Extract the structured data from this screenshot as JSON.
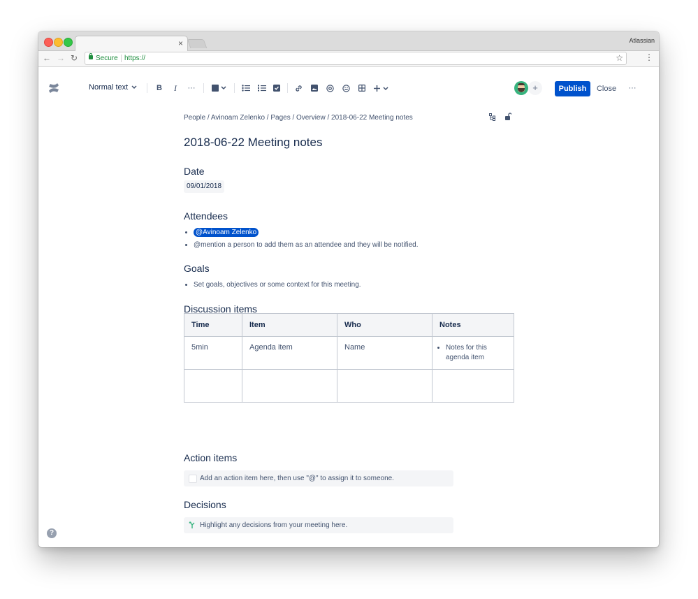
{
  "browser": {
    "profile_name": "Atlassian",
    "tab_close": "×",
    "nav": {
      "back": "←",
      "forward": "→",
      "reload": "↻"
    },
    "address": {
      "secure_label": "Secure",
      "url": "https://"
    },
    "star": "☆",
    "menu": "⋮"
  },
  "editor_toolbar": {
    "text_style": "Normal text",
    "bold": "B",
    "italic": "I",
    "more_formatting": "···",
    "publish_label": "Publish",
    "close_label": "Close",
    "more_label": "···",
    "add_collaborator": "+"
  },
  "page": {
    "breadcrumb": "People / Avinoam Zelenko / Pages / Overview / 2018-06-22 Meeting notes",
    "title": "2018-06-22 Meeting notes"
  },
  "sections": {
    "date": {
      "heading": "Date",
      "value": "09/01/2018"
    },
    "attendees": {
      "heading": "Attendees",
      "mention": "@Avinoam Zelenko",
      "hint": "@mention a person to add them as an attendee and they will be notified."
    },
    "goals": {
      "heading": "Goals",
      "items": [
        "Set goals, objectives or some context for this meeting."
      ]
    },
    "discussion": {
      "heading": "Discussion items",
      "columns": [
        "Time",
        "Item",
        "Who",
        "Notes"
      ],
      "rows": [
        {
          "time": "5min",
          "item": "Agenda item",
          "who": "Name",
          "notes": "Notes for this agenda item"
        }
      ]
    },
    "action_items": {
      "heading": "Action items",
      "placeholder": "Add an action item here, then use \"@\" to assign it to someone."
    },
    "decisions": {
      "heading": "Decisions",
      "placeholder": "Highlight any decisions from your meeting here."
    }
  },
  "help": "?",
  "colors": {
    "brand_blue": "#0052CC",
    "text": "#172B4D",
    "subtle": "#42526E",
    "panel": "#F4F5F7"
  }
}
